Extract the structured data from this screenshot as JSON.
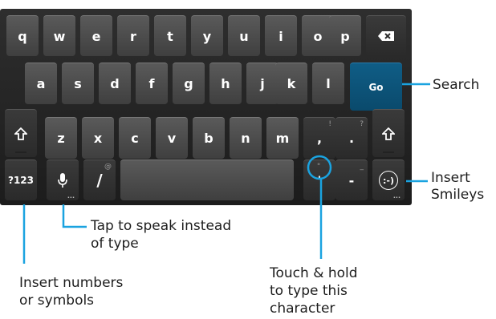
{
  "keyboard": {
    "row1": [
      "q",
      "w",
      "e",
      "r",
      "t",
      "y",
      "u",
      "i",
      "o",
      "p"
    ],
    "row2": [
      "a",
      "s",
      "d",
      "f",
      "g",
      "h",
      "j",
      "k",
      "l"
    ],
    "row3": [
      "z",
      "x",
      "c",
      "v",
      "b",
      "n",
      "m"
    ],
    "comma": ",",
    "comma_alt": "!",
    "period": ".",
    "period_alt": "?",
    "go_label": "Go",
    "symbols_label": "?123",
    "slash": "/",
    "slash_alt": "@",
    "apostrophe": "'",
    "apostrophe_alt": "\"",
    "dash": "-",
    "dash_alt": "_",
    "smiley_label": ":-)",
    "more_dots": "..."
  },
  "callouts": {
    "search": "Search",
    "smileys_line1": "Insert",
    "smileys_line2": "Smileys",
    "speak_line1": "Tap to speak instead",
    "speak_line2": "of type",
    "numbers_line1": "Insert numbers",
    "numbers_line2": "or symbols",
    "hold_line1": "Touch & hold",
    "hold_line2": "to type this",
    "hold_line3": "character"
  },
  "colors": {
    "callout": "#1aa3e0",
    "go_key": "#0a4a6c"
  },
  "icons": [
    "backspace-icon",
    "shift-icon",
    "microphone-icon"
  ]
}
